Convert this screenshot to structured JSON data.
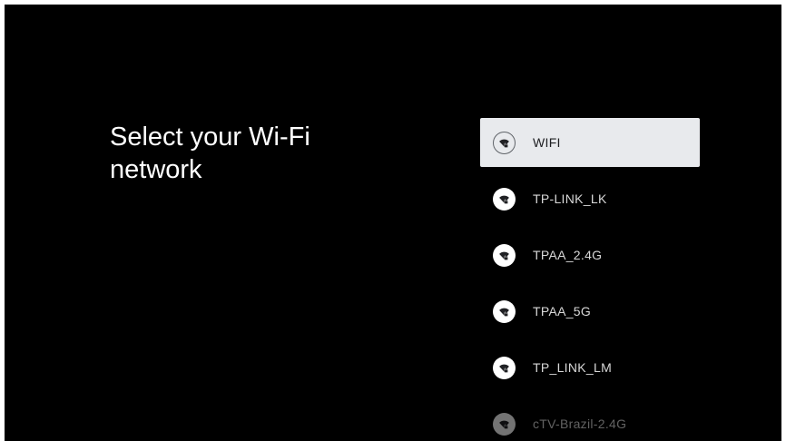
{
  "page": {
    "title": "Select your Wi-Fi network"
  },
  "networks": [
    {
      "name": "WIFI",
      "icon": "wifi-locked-icon",
      "selected": true
    },
    {
      "name": "TP-LINK_LK",
      "icon": "wifi-locked-icon",
      "selected": false
    },
    {
      "name": "TPAA_2.4G",
      "icon": "wifi-locked-icon",
      "selected": false
    },
    {
      "name": "TPAA_5G",
      "icon": "wifi-locked-icon",
      "selected": false
    },
    {
      "name": "TP_LINK_LM",
      "icon": "wifi-locked-icon",
      "selected": false
    },
    {
      "name": "cTV-Brazil-2.4G",
      "icon": "wifi-locked-icon",
      "selected": false
    }
  ],
  "colors": {
    "background": "#000000",
    "selected_background": "#e8eaed",
    "text": "#d8d8d8",
    "selected_text": "#202124"
  }
}
